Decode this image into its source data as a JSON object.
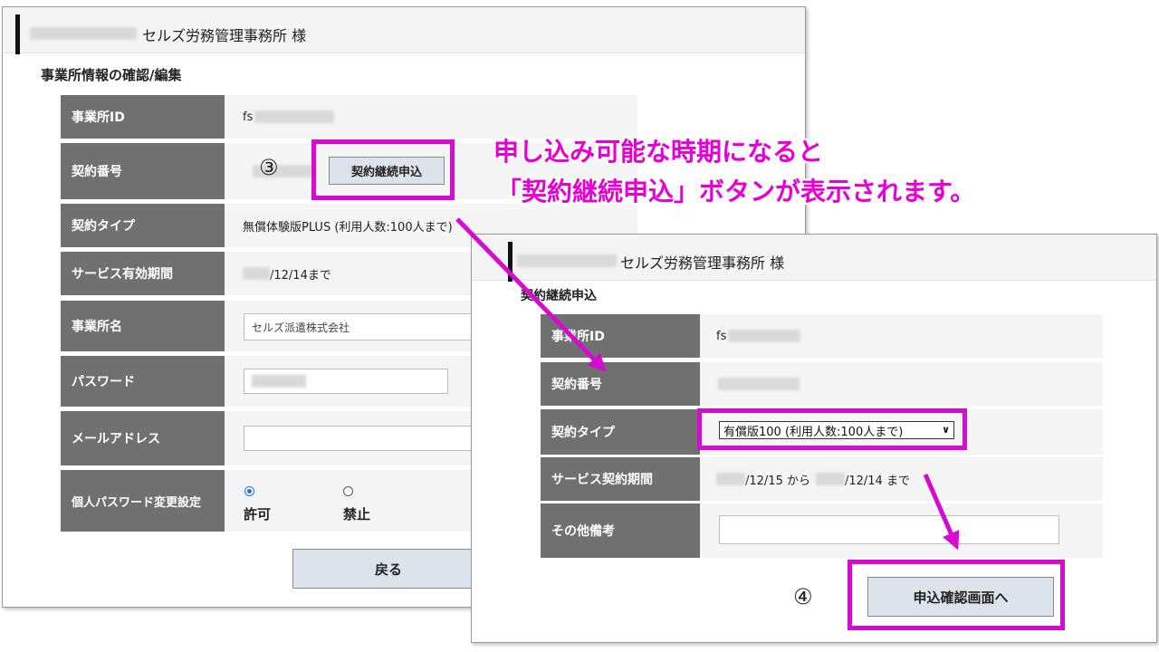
{
  "window1": {
    "office_name": "セルズ労務管理事務所 様",
    "section_title": "事業所情報の確認/編集",
    "rows": {
      "office_id": {
        "label": "事業所ID",
        "value": "fs"
      },
      "contract_no": {
        "label": "契約番号",
        "button": "契約継続申込"
      },
      "contract_type": {
        "label": "契約タイプ",
        "value": "無償体験版PLUS (利用人数:100人まで)"
      },
      "service_period": {
        "label": "サービス有効期間",
        "value": "/12/14まで"
      },
      "office_name_field": {
        "label": "事業所名",
        "value": "セルズ派遣株式会社"
      },
      "password": {
        "label": "パスワード"
      },
      "email": {
        "label": "メールアドレス"
      },
      "personal_pw": {
        "label": "個人パスワード変更設定",
        "allow": "許可",
        "deny": "禁止"
      }
    },
    "back_button": "戻る"
  },
  "window2": {
    "office_name": "セルズ労務管理事務所 様",
    "section_title": "契約継続申込",
    "rows": {
      "office_id": {
        "label": "事業所ID",
        "value": "fs"
      },
      "contract_no": {
        "label": "契約番号"
      },
      "contract_type": {
        "label": "契約タイプ",
        "selected": "有償版100 (利用人数:100人まで)"
      },
      "service_period": {
        "label": "サービス契約期間",
        "from": "/12/15 から",
        "to": "/12/14 まで"
      },
      "remarks": {
        "label": "その他備考"
      }
    },
    "confirm_button": "申込確認画面へ"
  },
  "annotation": {
    "line1": "申し込み可能な時期になると",
    "line2": "「契約継続申込」ボタンが表示されます。",
    "step3": "③",
    "step4": "④"
  },
  "colors": {
    "highlight": "#d60ad1",
    "annotation": "#e600d6",
    "label_bg": "#707070"
  }
}
